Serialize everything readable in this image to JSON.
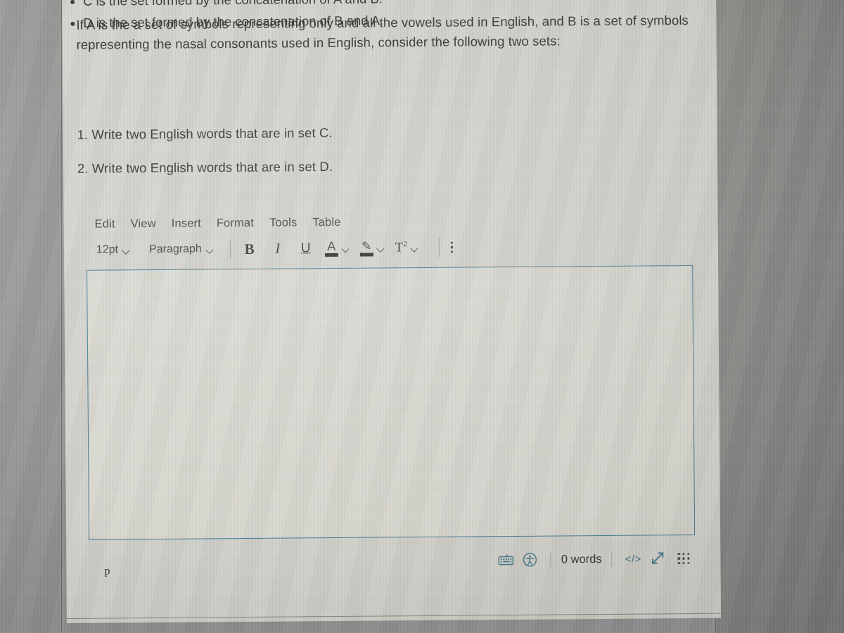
{
  "question": {
    "stem": "If A is the a set of symbols representing only and all the vowels used in English, and B is a set of symbols representing the nasal consonants used in English, consider the following two sets:",
    "bullets": [
      "C is the set formed by the concatenation of A and B.",
      "D is the set formed by the concatenation of B and A."
    ],
    "tasks": [
      "1. Write two English words that are in set C.",
      "2. Write two English words that are in set D."
    ]
  },
  "editor": {
    "menubar": [
      {
        "label": "Edit",
        "name": "menu-edit"
      },
      {
        "label": "View",
        "name": "menu-view"
      },
      {
        "label": "Insert",
        "name": "menu-insert"
      },
      {
        "label": "Format",
        "name": "menu-format"
      },
      {
        "label": "Tools",
        "name": "menu-tools"
      },
      {
        "label": "Table",
        "name": "menu-table"
      }
    ],
    "toolbar": {
      "font_size": "12pt",
      "block_format": "Paragraph",
      "bold_label": "B",
      "italic_label": "I",
      "underline_label": "U",
      "text_color_label": "A",
      "highlight_label": "✎",
      "superscript_label": "T",
      "superscript_exponent": "2",
      "more_label": "⋮"
    },
    "content": "",
    "placeholder": "",
    "statusbar": {
      "element_path": "p",
      "word_count": "0 words",
      "html_toggle": "</>",
      "keyboard_icon": "keyboard-shortcuts-icon",
      "accessibility_icon": "accessibility-checker-icon",
      "fullscreen_icon": "fullscreen-expand-icon",
      "resize_icon": "resize-grip-icon"
    }
  },
  "colors": {
    "editor_border": "#3c7490",
    "accent_teal": "#3d7186",
    "text": "#2b2b2b",
    "card_bg": "#d5d4cd",
    "gutter_bg": "#8e8e8e"
  }
}
